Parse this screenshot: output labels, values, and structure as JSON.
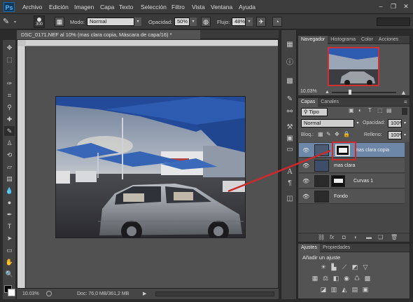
{
  "app": {
    "logo": "Ps"
  },
  "menu": [
    "Archivo",
    "Edición",
    "Imagen",
    "Capa",
    "Texto",
    "Selección",
    "Filtro",
    "Vista",
    "Ventana",
    "Ayuda"
  ],
  "options": {
    "brush_size": "300",
    "mode_label": "Modo:",
    "mode_value": "Normal",
    "opacity_label": "Opacidad:",
    "opacity_value": "50%",
    "flow_label": "Flujo:",
    "flow_value": "48%"
  },
  "document": {
    "tab_title": "DSC_0171.NEF al 10% (mas clara copia, Máscara de capa/16) *",
    "zoom": "10.03%",
    "doc_info": "Doc: 76,0 MB/361,2 MB"
  },
  "navigator": {
    "tabs": [
      "Navegador",
      "Histograma",
      "Color",
      "Acciones"
    ],
    "zoom": "10.03%"
  },
  "layers_panel": {
    "tabs": [
      "Capas",
      "Canales"
    ],
    "filter_label": "Tipo",
    "blend_mode": "Normal",
    "opacity_label": "Opacidad:",
    "opacity_value": "100%",
    "lock_label": "Bloq.:",
    "fill_label": "Relleno:",
    "fill_value": "100%",
    "layers": [
      {
        "name": "mas clara copia",
        "selected": true
      },
      {
        "name": "mas clara",
        "selected": false
      },
      {
        "name": "Curvas 1",
        "selected": false
      },
      {
        "name": "Fondo",
        "selected": false
      }
    ]
  },
  "adjustments": {
    "tabs": [
      "Ajustes",
      "Propiedades"
    ],
    "title": "Añadir un ajuste"
  },
  "colors": {
    "selected_layer": "#6d87a8",
    "annotation": "#cc2a2a"
  }
}
